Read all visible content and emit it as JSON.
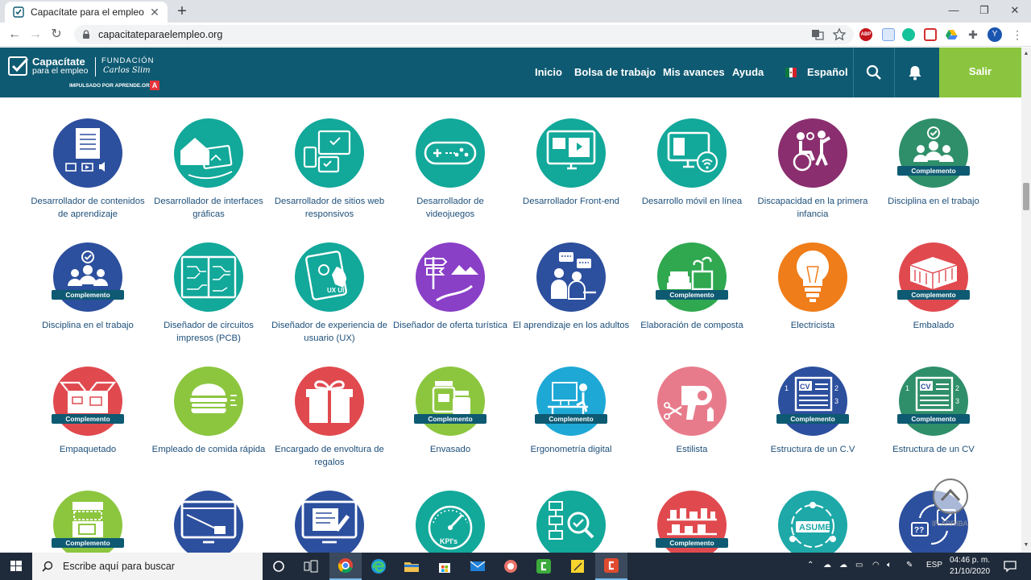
{
  "browser": {
    "tab_title": "Capacítate para el empleo",
    "new_tab": "+",
    "url": "capacitateparaelempleo.org",
    "window_controls": [
      "—",
      "❐",
      "✕"
    ],
    "profile_initial": "Y",
    "adblock_label": "ABP"
  },
  "site": {
    "logo_text_1": "Capacítate",
    "logo_text_2": "para el empleo",
    "logo_fundacion": "FUNDACIÓN",
    "logo_carlos": "Carlos Slim",
    "logo_impulsado": "IMPULSADO POR APRENDE.ORG",
    "nav": [
      "Inicio",
      "Bolsa de trabajo",
      "Mis avances",
      "Ayuda"
    ],
    "language": "Español",
    "logout": "Salir",
    "colors": {
      "header": "#0e5a72",
      "logout": "#8bc53f",
      "link": "#1d4f7a"
    }
  },
  "complement_label": "Complemento",
  "courses": [
    {
      "label": "Desarrollador de contenidos de aprendizaje",
      "color": "#2c4f9e",
      "icon": "presentation-board-icon",
      "complement": false
    },
    {
      "label": "Desarrollador de interfaces gráficas",
      "color": "#12a89a",
      "icon": "house-tablet-icon",
      "complement": false
    },
    {
      "label": "Desarrollador de sitios web responsivos",
      "color": "#12a89a",
      "icon": "responsive-devices-icon",
      "complement": false
    },
    {
      "label": "Desarrollador de videojuegos",
      "color": "#12a89a",
      "icon": "gamepad-icon",
      "complement": false
    },
    {
      "label": "Desarrollador Front-end",
      "color": "#12a89a",
      "icon": "monitor-video-icon",
      "complement": false
    },
    {
      "label": "Desarrollo móvil en línea",
      "color": "#12a89a",
      "icon": "monitor-wifi-icon",
      "complement": false
    },
    {
      "label": "Discapacidad en la primera infancia",
      "color": "#8a2e6f",
      "icon": "wheelchair-child-icon",
      "complement": false
    },
    {
      "label": "Disciplina en el trabajo",
      "color": "#2f8f6a",
      "icon": "team-check-icon",
      "complement": true
    },
    {
      "label": "Disciplina en el trabajo",
      "color": "#2c4f9e",
      "icon": "team-check-icon",
      "complement": true
    },
    {
      "label": "Diseñador de circuitos impresos (PCB)",
      "color": "#12a89a",
      "icon": "circuit-board-icon",
      "complement": false
    },
    {
      "label": "Diseñador de experiencia de usuario (UX)",
      "color": "#12a89a",
      "icon": "tablet-touch-icon",
      "complement": false
    },
    {
      "label": "Diseñador de oferta turística",
      "color": "#8a3fc7",
      "icon": "signpost-mountains-icon",
      "complement": false
    },
    {
      "label": "El aprendizaje en los adultos",
      "color": "#2c4f9e",
      "icon": "adults-chat-icon",
      "complement": false
    },
    {
      "label": "Elaboración de composta",
      "color": "#2fa84f",
      "icon": "compost-plant-icon",
      "complement": true
    },
    {
      "label": "Electricista",
      "color": "#ef7d1a",
      "icon": "light-bulb-icon",
      "complement": false
    },
    {
      "label": "Embalado",
      "color": "#e04a4f",
      "icon": "boxes-stack-icon",
      "complement": true
    },
    {
      "label": "Empaquetado",
      "color": "#e04a4f",
      "icon": "open-box-icon",
      "complement": true
    },
    {
      "label": "Empleado de comida rápida",
      "color": "#8cc63f",
      "icon": "burger-icon",
      "complement": false
    },
    {
      "label": "Encargado de envoltura de regalos",
      "color": "#e04a4f",
      "icon": "gift-icon",
      "complement": false
    },
    {
      "label": "Envasado",
      "color": "#8cc63f",
      "icon": "jars-icon",
      "complement": true
    },
    {
      "label": "Ergonometría digital",
      "color": "#1ea8d6",
      "icon": "desk-worker-icon",
      "complement": true
    },
    {
      "label": "Estilista",
      "color": "#e87b8b",
      "icon": "hair-dryer-icon",
      "complement": false
    },
    {
      "label": "Estructura de un C.V",
      "color": "#2c4f9e",
      "icon": "cv-document-icon",
      "complement": true
    },
    {
      "label": "Estructura de un CV",
      "color": "#2f8f6a",
      "icon": "cv-document-icon",
      "complement": true
    },
    {
      "label": "",
      "color": "#8cc63f",
      "icon": "canned-food-icon",
      "complement": true
    },
    {
      "label": "",
      "color": "#2c4f9e",
      "icon": "web-monitor-icon",
      "complement": false
    },
    {
      "label": "",
      "color": "#2c4f9e",
      "icon": "monitor-edit-icon",
      "complement": false
    },
    {
      "label": "",
      "color": "#12a89a",
      "icon": "kpi-gauge-icon",
      "complement": false
    },
    {
      "label": "",
      "color": "#12a89a",
      "icon": "flowchart-search-icon",
      "complement": false
    },
    {
      "label": "",
      "color": "#e04a4f",
      "icon": "shelves-icon",
      "complement": true
    },
    {
      "label": "",
      "color": "#1ea8a8",
      "icon": "assume-team-icon",
      "complement": false
    },
    {
      "label": "",
      "color": "#2c4f9e",
      "icon": "question-cycle-icon",
      "complement": false
    }
  ],
  "asume_text": "ASUME",
  "kpi_text": "KPI's",
  "cv_text": "CV",
  "scroll_top_text": "IR ARRIBA",
  "taskbar": {
    "search_placeholder": "Escribe aquí para buscar",
    "language": "ESP",
    "time": "04:46 p. m.",
    "date": "21/10/2020"
  }
}
